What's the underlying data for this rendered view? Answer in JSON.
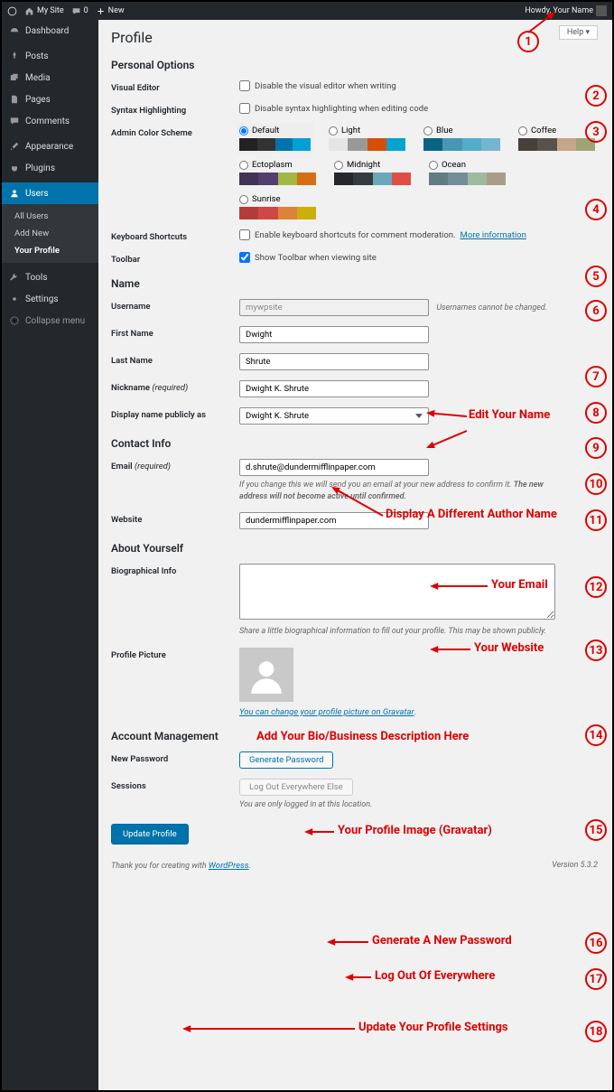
{
  "adminbar": {
    "site": "My Site",
    "comments": "0",
    "new": "New",
    "howdy": "Howdy, Your Name"
  },
  "sidebar": {
    "items": [
      {
        "label": "Dashboard",
        "icon": "dashboard"
      },
      {
        "label": "Posts",
        "icon": "pin"
      },
      {
        "label": "Media",
        "icon": "media"
      },
      {
        "label": "Pages",
        "icon": "page"
      },
      {
        "label": "Comments",
        "icon": "comment"
      },
      {
        "label": "Appearance",
        "icon": "brush"
      },
      {
        "label": "Plugins",
        "icon": "plug"
      },
      {
        "label": "Users",
        "icon": "user",
        "active": true
      },
      {
        "label": "Tools",
        "icon": "wrench"
      },
      {
        "label": "Settings",
        "icon": "gear"
      }
    ],
    "sub_users": [
      {
        "label": "All Users"
      },
      {
        "label": "Add New"
      },
      {
        "label": "Your Profile",
        "current": true
      }
    ],
    "collapse": "Collapse menu"
  },
  "help": "Help ▾",
  "page_title": "Profile",
  "sections": {
    "personal": "Personal Options",
    "name": "Name",
    "contact": "Contact Info",
    "about": "About Yourself",
    "account": "Account Management"
  },
  "fields": {
    "visual_editor": {
      "label": "Visual Editor",
      "check": "Disable the visual editor when writing"
    },
    "syntax": {
      "label": "Syntax Highlighting",
      "check": "Disable syntax highlighting when editing code"
    },
    "scheme": {
      "label": "Admin Color Scheme"
    },
    "shortcuts": {
      "label": "Keyboard Shortcuts",
      "check": "Enable keyboard shortcuts for comment moderation.",
      "link": "More information"
    },
    "toolbar": {
      "label": "Toolbar",
      "check": "Show Toolbar when viewing site"
    },
    "username": {
      "label": "Username",
      "value": "mywpsite",
      "note": "Usernames cannot be changed."
    },
    "first": {
      "label": "First Name",
      "value": "Dwight"
    },
    "last": {
      "label": "Last Name",
      "value": "Shrute"
    },
    "nickname": {
      "label": "Nickname",
      "req": "(required)",
      "value": "Dwight K. Shrute"
    },
    "display": {
      "label": "Display name publicly as",
      "value": "Dwight K. Shrute"
    },
    "email": {
      "label": "Email",
      "req": "(required)",
      "value": "d.shrute@dundermifflinpaper.com",
      "desc1": "If you change this we will send you an email at your new address to confirm it. ",
      "desc2": "The new address will not become active until confirmed."
    },
    "website": {
      "label": "Website",
      "value": "dundermifflinpaper.com"
    },
    "bio": {
      "label": "Biographical Info",
      "desc": "Share a little biographical information to fill out your profile. This may be shown publicly."
    },
    "picture": {
      "label": "Profile Picture",
      "link": "You can change your profile picture on Gravatar",
      "dot": "."
    },
    "password": {
      "label": "New Password",
      "btn": "Generate Password"
    },
    "sessions": {
      "label": "Sessions",
      "btn": "Log Out Everywhere Else",
      "desc": "You are only logged in at this location."
    }
  },
  "color_schemes": [
    {
      "name": "Default",
      "selected": true,
      "colors": [
        "#222",
        "#333",
        "#0073aa",
        "#00a0d2"
      ]
    },
    {
      "name": "Light",
      "selected": false,
      "colors": [
        "#e5e5e5",
        "#999",
        "#d64e07",
        "#04a4cc"
      ]
    },
    {
      "name": "Blue",
      "selected": false,
      "colors": [
        "#096484",
        "#4796b3",
        "#52accc",
        "#74B6CE"
      ]
    },
    {
      "name": "Coffee",
      "selected": false,
      "colors": [
        "#46403c",
        "#59524c",
        "#c7a589",
        "#9ea476"
      ]
    },
    {
      "name": "Ectoplasm",
      "selected": false,
      "colors": [
        "#413256",
        "#523f6d",
        "#a3b745",
        "#d46f15"
      ]
    },
    {
      "name": "Midnight",
      "selected": false,
      "colors": [
        "#25282b",
        "#363b3f",
        "#69a8bb",
        "#e14d43"
      ]
    },
    {
      "name": "Ocean",
      "selected": false,
      "colors": [
        "#627c83",
        "#738e96",
        "#9ebaa0",
        "#aa9d88"
      ]
    },
    {
      "name": "Sunrise",
      "selected": false,
      "colors": [
        "#b43c38",
        "#cf4944",
        "#dd823b",
        "#ccaf0b"
      ]
    }
  ],
  "submit": "Update Profile",
  "footer": {
    "thank": "Thank you for creating with ",
    "wp": "WordPress",
    "dot": ".",
    "version": "Version 5.3.2"
  },
  "annotations": {
    "1": "1",
    "2": "2",
    "3": "3",
    "4": "4",
    "5": "5",
    "6": "6",
    "7": "7",
    "8": "8",
    "9": "9",
    "10": "10",
    "11": "11",
    "12": "12",
    "13": "13",
    "14": "14",
    "15": "15",
    "16": "16",
    "17": "17",
    "18": "18",
    "edit_name": "Edit Your Name",
    "display_name": "Display A Different Author Name",
    "your_email": "Your Email",
    "your_website": "Your Website",
    "bio_text": "Add Your Bio/Business Description Here",
    "profile_img": "Your Profile Image (Gravatar)",
    "gen_pwd": "Generate A New Password",
    "logout": "Log Out Of Everywhere",
    "update": "Update Your Profile Settings"
  }
}
